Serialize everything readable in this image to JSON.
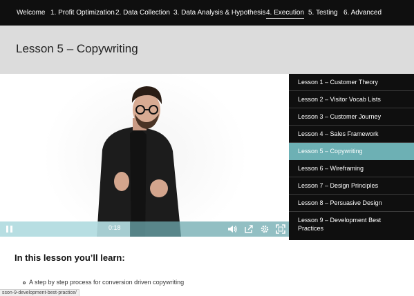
{
  "nav": {
    "items": [
      {
        "label": "Welcome"
      },
      {
        "label": "1. Profit Optimization"
      },
      {
        "label": "2. Data Collection"
      },
      {
        "label": "3. Data Analysis & Hypothesis"
      },
      {
        "label": "4. Execution",
        "active": true
      },
      {
        "label": "5. Testing"
      },
      {
        "label": "6. Advanced"
      }
    ]
  },
  "page": {
    "title": "Lesson 5 – Copywriting"
  },
  "video": {
    "time": "0:18",
    "progress": 0.45,
    "state": "playing",
    "icons": [
      "pause-icon",
      "volume-icon",
      "share-icon",
      "settings-icon",
      "fullscreen-icon"
    ]
  },
  "lessons": [
    {
      "label": "Lesson 1 – Customer Theory"
    },
    {
      "label": "Lesson 2 – Visitor Vocab Lists"
    },
    {
      "label": "Lesson 3 – Customer Journey"
    },
    {
      "label": "Lesson 4 – Sales Framework"
    },
    {
      "label": "Lesson 5 – Copywriting",
      "active": true
    },
    {
      "label": "Lesson 6 – Wireframing"
    },
    {
      "label": "Lesson 7 – Design Principles"
    },
    {
      "label": "Lesson 8 – Persuasive Design"
    },
    {
      "label": "Lesson 9 – Development Best Practices"
    }
  ],
  "content": {
    "heading": "In this lesson you’ll learn:",
    "bullets": [
      "A step by step process for conversion driven copywriting"
    ]
  },
  "status": {
    "url": "sson-9-development-best-practice/"
  },
  "colors": {
    "accent": "#6db0b4",
    "nav_bg": "#0f0f0f",
    "title_band": "#dcdcdc"
  }
}
